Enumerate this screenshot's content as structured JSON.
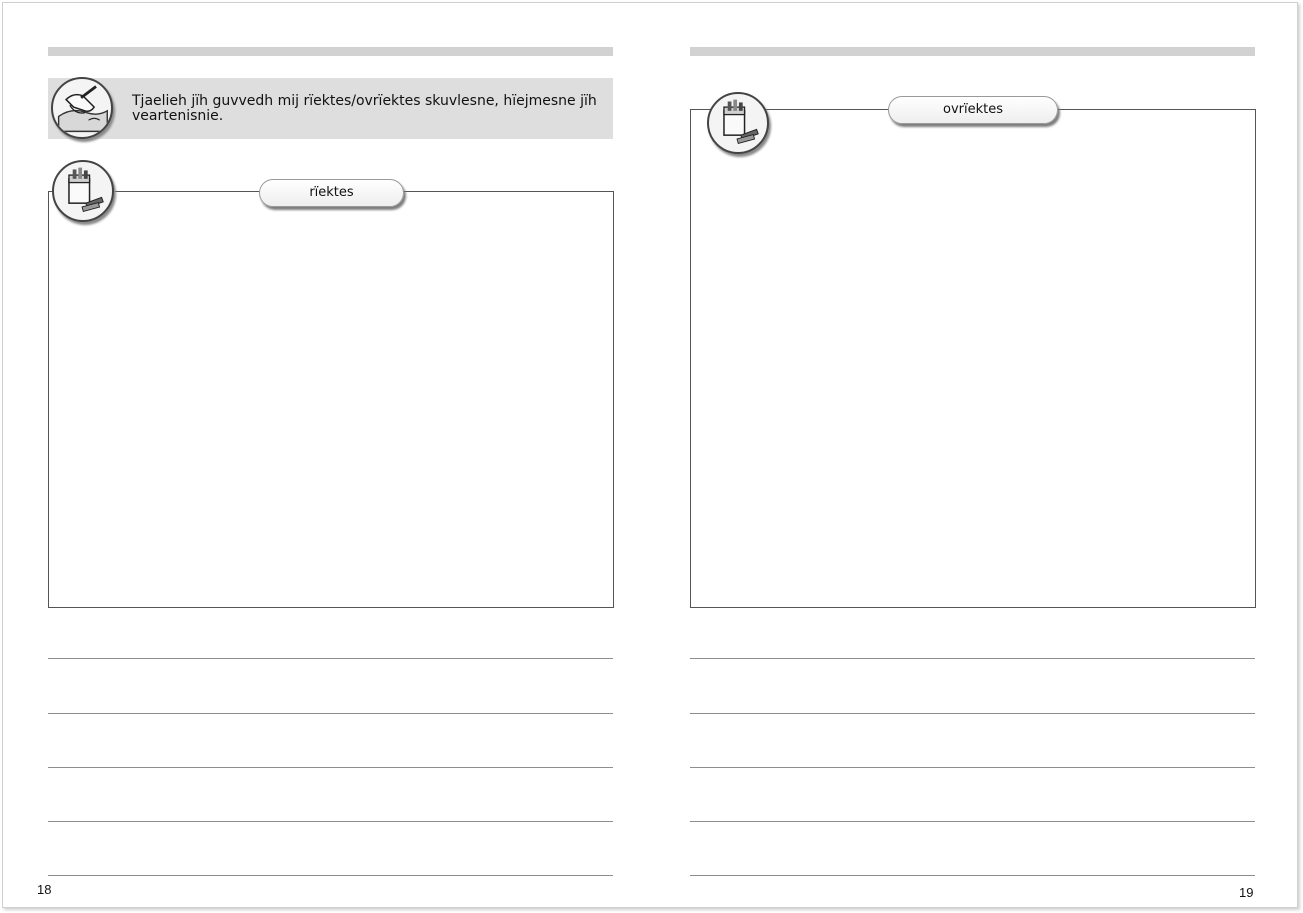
{
  "left_page": {
    "instruction": "Tjaelieh jïh guvvedh mij rïektes/ovrïektes skuvlesne, hïejmesne jïh veartenisnie.",
    "tab_label": "rïektes",
    "page_number": "18"
  },
  "right_page": {
    "tab_label": "ovrïektes",
    "page_number": "19"
  },
  "icons": {
    "instruction": "hand-writing-icon",
    "left_frame": "crayons-box-icon",
    "right_frame": "crayons-box-icon"
  }
}
